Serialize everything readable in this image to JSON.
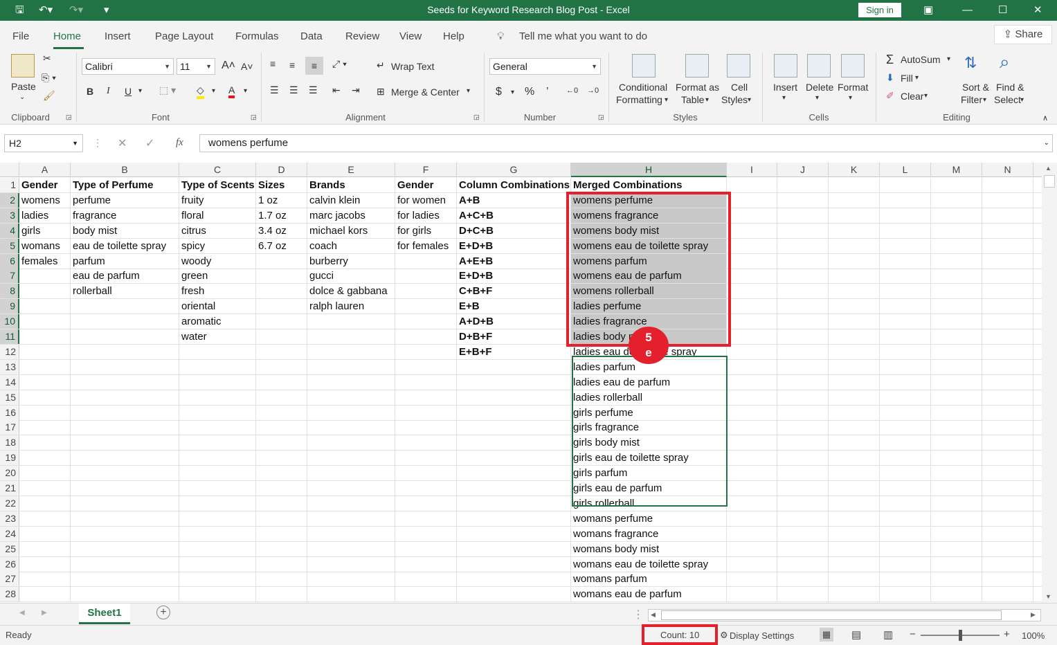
{
  "window": {
    "title": "Seeds for Keyword Research Blog Post  -  Excel",
    "sign_in": "Sign in"
  },
  "menu": {
    "items": [
      "File",
      "Home",
      "Insert",
      "Page Layout",
      "Formulas",
      "Data",
      "Review",
      "View",
      "Help"
    ],
    "tell_me": "Tell me what you want to do",
    "share": "Share"
  },
  "ribbon": {
    "clipboard": {
      "paste": "Paste",
      "group": "Clipboard"
    },
    "font": {
      "name": "Calibri",
      "size": "11",
      "group": "Font",
      "bold": "B",
      "italic": "I",
      "underline": "U"
    },
    "alignment": {
      "wrap": "Wrap Text",
      "merge": "Merge & Center",
      "group": "Alignment"
    },
    "number": {
      "format": "General",
      "currency": "$",
      "percent": "%",
      "comma": "’",
      "group": "Number"
    },
    "styles": {
      "cond1": "Conditional",
      "cond2": "Formatting",
      "fmt1": "Format as",
      "fmt2": "Table",
      "cell1": "Cell",
      "cell2": "Styles",
      "group": "Styles"
    },
    "cells": {
      "insert": "Insert",
      "delete": "Delete",
      "format": "Format",
      "group": "Cells"
    },
    "editing": {
      "autosum": "AutoSum",
      "fill": "Fill",
      "clear": "Clear",
      "sort1": "Sort &",
      "sort2": "Filter",
      "find1": "Find &",
      "find2": "Select",
      "group": "Editing"
    }
  },
  "formula_bar": {
    "name_box": "H2",
    "fx": "fx",
    "value": "womens perfume"
  },
  "columns": [
    "A",
    "B",
    "C",
    "D",
    "E",
    "F",
    "G",
    "H",
    "I",
    "J",
    "K",
    "L",
    "M",
    "N"
  ],
  "rows": [
    {
      "n": "1",
      "A": "Gender",
      "B": "Type of Perfume",
      "C": "Type of Scents",
      "D": "Sizes",
      "E": "Brands",
      "F": "Gender",
      "G": "Column Combinations",
      "H": "Merged Combinations"
    },
    {
      "n": "2",
      "A": "womens",
      "B": "perfume",
      "C": "fruity",
      "D": "1 oz",
      "E": "calvin klein",
      "F": "for women",
      "G": "A+B",
      "H": "womens perfume"
    },
    {
      "n": "3",
      "A": "ladies",
      "B": "fragrance",
      "C": "floral",
      "D": "1.7 oz",
      "E": "marc jacobs",
      "F": "for ladies",
      "G": "A+C+B",
      "H": "womens fragrance"
    },
    {
      "n": "4",
      "A": "girls",
      "B": "body mist",
      "C": "citrus",
      "D": "3.4 oz",
      "E": "michael kors",
      "F": "for girls",
      "G": "D+C+B",
      "H": "womens body mist"
    },
    {
      "n": "5",
      "A": "womans",
      "B": "eau de toilette spray",
      "C": "spicy",
      "D": "6.7 oz",
      "E": "coach",
      "F": "for females",
      "G": "E+D+B",
      "H": "womens eau de toilette spray"
    },
    {
      "n": "6",
      "A": "females",
      "B": "parfum",
      "C": "woody",
      "D": "",
      "E": "burberry",
      "F": "",
      "G": "A+E+B",
      "H": "womens parfum"
    },
    {
      "n": "7",
      "A": "",
      "B": "eau de parfum",
      "C": "green",
      "D": "",
      "E": "gucci",
      "F": "",
      "G": "E+D+B",
      "H": "womens eau de parfum"
    },
    {
      "n": "8",
      "A": "",
      "B": "rollerball",
      "C": "fresh",
      "D": "",
      "E": "dolce & gabbana",
      "F": "",
      "G": "C+B+F",
      "H": "womens rollerball"
    },
    {
      "n": "9",
      "A": "",
      "B": "",
      "C": "oriental",
      "D": "",
      "E": "ralph lauren",
      "F": "",
      "G": "E+B",
      "H": "ladies perfume"
    },
    {
      "n": "10",
      "A": "",
      "B": "",
      "C": "aromatic",
      "D": "",
      "E": "",
      "F": "",
      "G": "A+D+B",
      "H": "ladies fragrance"
    },
    {
      "n": "11",
      "A": "",
      "B": "",
      "C": "water",
      "D": "",
      "E": "",
      "F": "",
      "G": "D+B+F",
      "H": "ladies body mist"
    },
    {
      "n": "12",
      "A": "",
      "B": "",
      "C": "",
      "D": "",
      "E": "",
      "F": "",
      "G": "E+B+F",
      "H": "ladies eau de toilette spray"
    },
    {
      "n": "13",
      "A": "",
      "B": "",
      "C": "",
      "D": "",
      "E": "",
      "F": "",
      "G": "",
      "H": "ladies parfum"
    },
    {
      "n": "14",
      "A": "",
      "B": "",
      "C": "",
      "D": "",
      "E": "",
      "F": "",
      "G": "",
      "H": "ladies eau de parfum"
    },
    {
      "n": "15",
      "A": "",
      "B": "",
      "C": "",
      "D": "",
      "E": "",
      "F": "",
      "G": "",
      "H": "ladies rollerball"
    },
    {
      "n": "16",
      "A": "",
      "B": "",
      "C": "",
      "D": "",
      "E": "",
      "F": "",
      "G": "",
      "H": "girls perfume"
    },
    {
      "n": "17",
      "A": "",
      "B": "",
      "C": "",
      "D": "",
      "E": "",
      "F": "",
      "G": "",
      "H": "girls fragrance"
    },
    {
      "n": "18",
      "A": "",
      "B": "",
      "C": "",
      "D": "",
      "E": "",
      "F": "",
      "G": "",
      "H": "girls body mist"
    },
    {
      "n": "19",
      "A": "",
      "B": "",
      "C": "",
      "D": "",
      "E": "",
      "F": "",
      "G": "",
      "H": "girls eau de toilette spray"
    },
    {
      "n": "20",
      "A": "",
      "B": "",
      "C": "",
      "D": "",
      "E": "",
      "F": "",
      "G": "",
      "H": "girls parfum"
    },
    {
      "n": "21",
      "A": "",
      "B": "",
      "C": "",
      "D": "",
      "E": "",
      "F": "",
      "G": "",
      "H": "girls eau de parfum"
    },
    {
      "n": "22",
      "A": "",
      "B": "",
      "C": "",
      "D": "",
      "E": "",
      "F": "",
      "G": "",
      "H": "girls rollerball"
    },
    {
      "n": "23",
      "A": "",
      "B": "",
      "C": "",
      "D": "",
      "E": "",
      "F": "",
      "G": "",
      "H": "womans perfume"
    },
    {
      "n": "24",
      "A": "",
      "B": "",
      "C": "",
      "D": "",
      "E": "",
      "F": "",
      "G": "",
      "H": "womans fragrance"
    },
    {
      "n": "25",
      "A": "",
      "B": "",
      "C": "",
      "D": "",
      "E": "",
      "F": "",
      "G": "",
      "H": "womans body mist"
    },
    {
      "n": "26",
      "A": "",
      "B": "",
      "C": "",
      "D": "",
      "E": "",
      "F": "",
      "G": "",
      "H": "womans eau de toilette spray"
    },
    {
      "n": "27",
      "A": "",
      "B": "",
      "C": "",
      "D": "",
      "E": "",
      "F": "",
      "G": "",
      "H": "womans parfum"
    },
    {
      "n": "28",
      "A": "",
      "B": "",
      "C": "",
      "D": "",
      "E": "",
      "F": "",
      "G": "",
      "H": "womans eau de parfum"
    }
  ],
  "badge": {
    "line1": "5",
    "line2": "e"
  },
  "sheet_tab": "Sheet1",
  "status": {
    "ready": "Ready",
    "count": "Count: 10",
    "display": "Display Settings",
    "zoom": "100%"
  },
  "colors": {
    "accent": "#217346",
    "highlight": "#e4202c"
  }
}
